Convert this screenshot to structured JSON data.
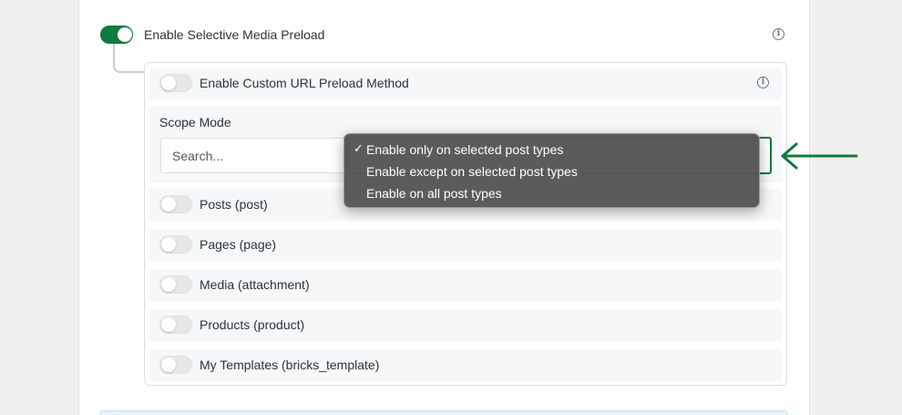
{
  "main_toggle": {
    "label": "Enable Selective Media Preload",
    "on": true
  },
  "custom_url": {
    "label": "Enable Custom URL Preload Method",
    "on": false
  },
  "scope": {
    "label": "Scope Mode",
    "search_placeholder": "Search...",
    "options": [
      {
        "label": "Enable only on selected post types",
        "selected": true
      },
      {
        "label": "Enable except on selected post types",
        "selected": false
      },
      {
        "label": "Enable on all post types",
        "selected": false
      }
    ],
    "check_glyph": "✓"
  },
  "post_types": [
    {
      "label": "Posts (post)",
      "on": false
    },
    {
      "label": "Pages (page)",
      "on": false
    },
    {
      "label": "Media (attachment)",
      "on": false
    },
    {
      "label": "Products (product)",
      "on": false
    },
    {
      "label": "My Templates (bricks_template)",
      "on": false
    }
  ],
  "icons": {
    "info": "info-icon",
    "check": "checkmark-icon",
    "arrow": "left-arrow-icon"
  },
  "colors": {
    "accent": "#0f7a3e",
    "toggle_off": "#e6e7e9",
    "dropdown_bg": "#565656"
  }
}
